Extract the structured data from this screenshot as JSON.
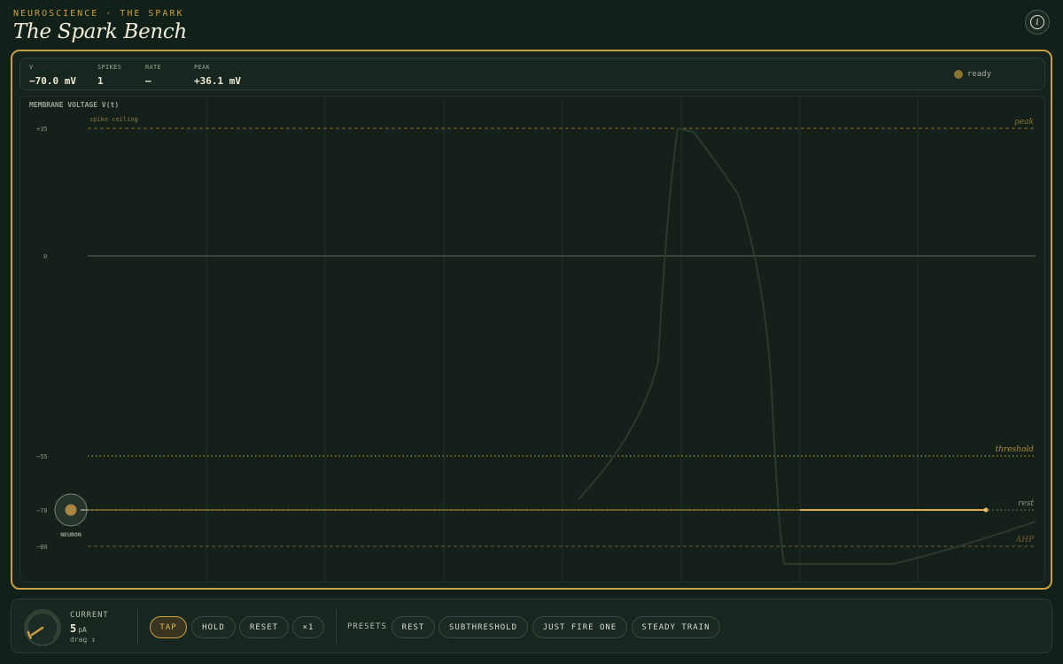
{
  "header": {
    "eyebrow": "NEUROSCIENCE · THE SPARK",
    "title": "The Spark Bench",
    "info_icon": "i"
  },
  "stats": {
    "v_label": "V",
    "v_value": "−70.0 mV",
    "spikes_label": "SPIKES",
    "spikes_value": "1",
    "rate_label": "RATE",
    "rate_value": "—",
    "peak_label": "PEAK",
    "peak_value": "+36.1 mV",
    "status": "ready"
  },
  "scope": {
    "label": "MEMBRANE VOLTAGE  V(t)",
    "ceiling_label": "spike ceiling",
    "axis_ticks": [
      "+35",
      "0",
      "−55",
      "−70",
      "−80"
    ],
    "line_peak": "peak",
    "line_threshold": "threshold",
    "line_rest": "rest",
    "line_ahp": "AHP",
    "neuron_label": "NEURON"
  },
  "controls": {
    "current_label": "CURRENT",
    "current_value": "5",
    "current_unit": "pA",
    "drag_hint": "drag ↕",
    "tap": "TAP",
    "hold": "HOLD",
    "reset": "RESET",
    "speed": "×1",
    "presets_label": "PRESETS",
    "presets": [
      "REST",
      "SUBTHRESHOLD",
      "JUST FIRE ONE",
      "STEADY TRAIN"
    ]
  },
  "colors": {
    "accent": "#c9a045",
    "background": "#12201a",
    "panel": "#15231c"
  }
}
